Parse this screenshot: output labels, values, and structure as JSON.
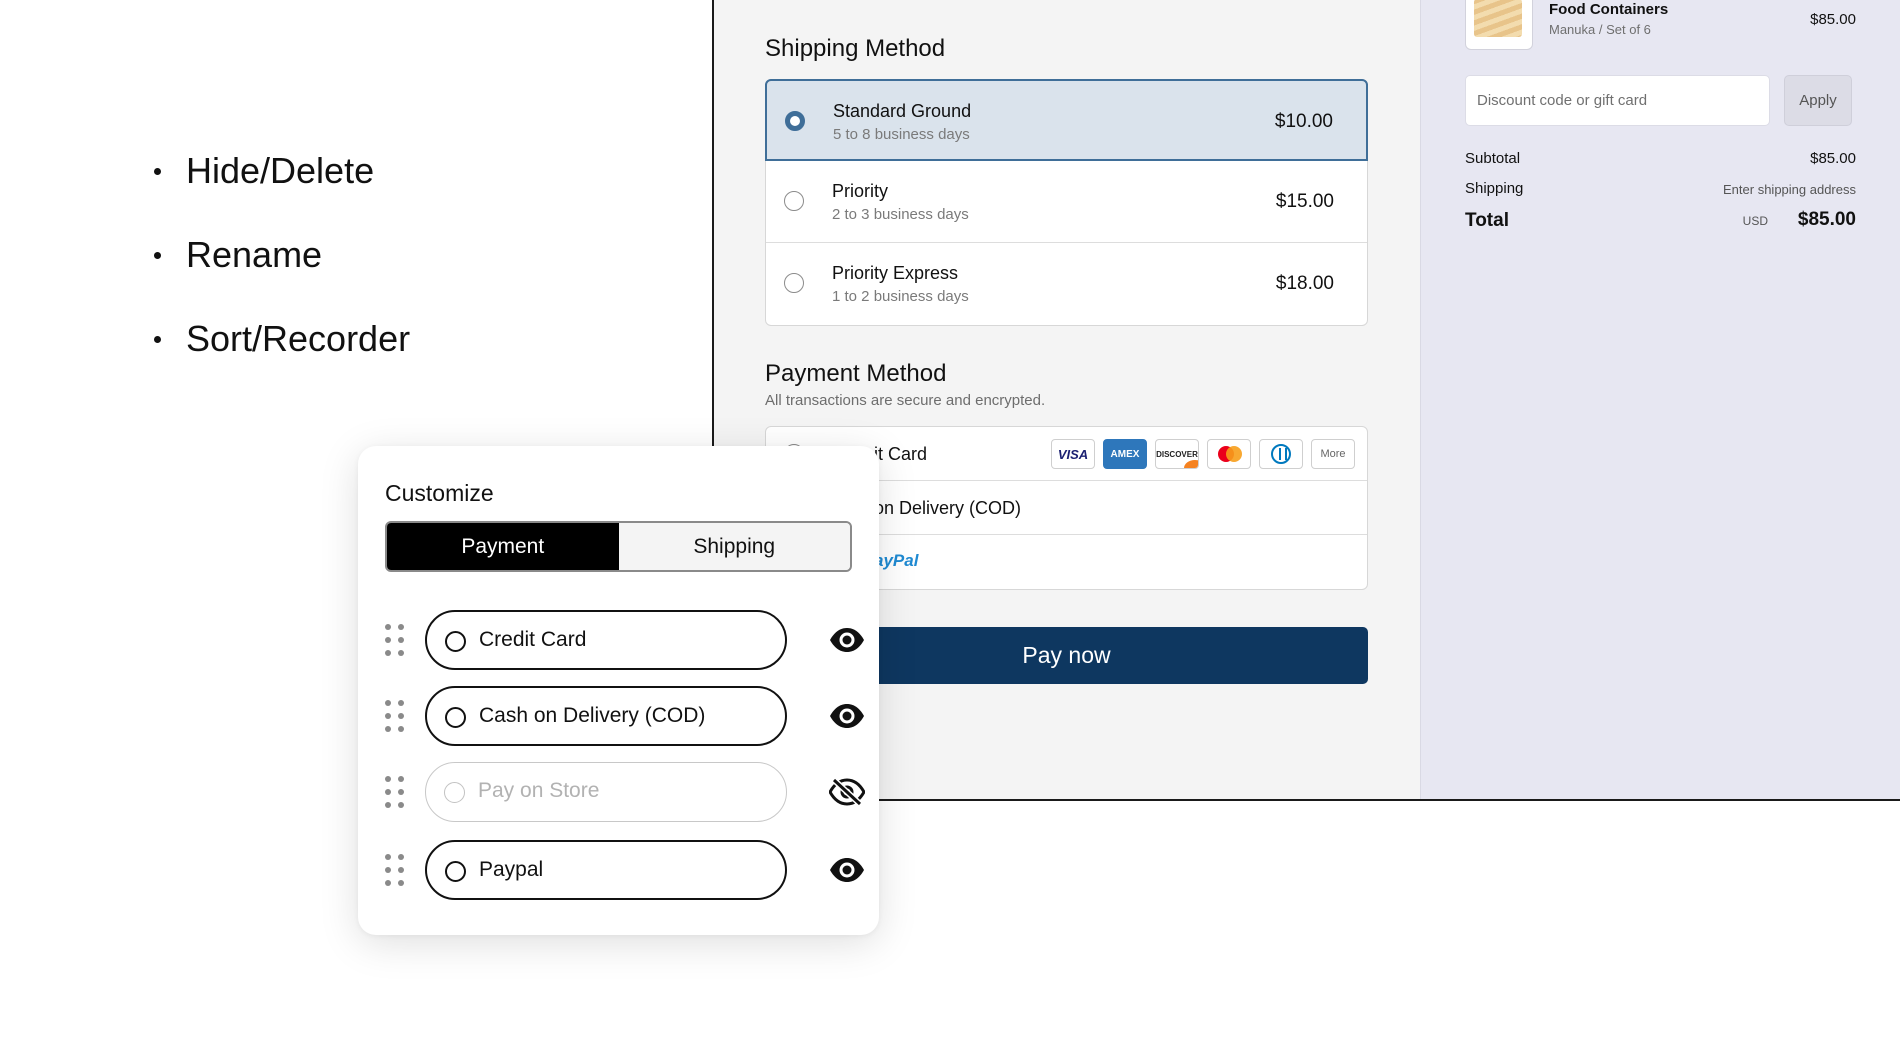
{
  "features": [
    "Hide/Delete",
    "Rename",
    "Sort/Recorder"
  ],
  "checkout": {
    "shipping": {
      "title": "Shipping Method",
      "options": [
        {
          "name": "Standard Ground",
          "days": "5 to 8 business days",
          "price": "$10.00",
          "selected": true
        },
        {
          "name": "Priority",
          "days": "2 to 3 business days",
          "price": "$15.00",
          "selected": false
        },
        {
          "name": "Priority Express",
          "days": "1 to 2 business days",
          "price": "$18.00",
          "selected": false
        }
      ]
    },
    "payment": {
      "title": "Payment Method",
      "subtitle": "All transactions are secure and encrypted.",
      "options": [
        {
          "label": "it Card"
        },
        {
          "label": "on Delivery (COD)"
        },
        {
          "label": "ayPal"
        }
      ],
      "card_logos": [
        "VISA",
        "AMEX",
        "DISCOVER",
        "mastercard",
        "diners",
        "More"
      ],
      "pay_button": "Pay now",
      "colors": {
        "accent": "#3f6e98",
        "pay_button": "#0e3760",
        "paypal": "#1f8ad2"
      }
    },
    "summary": {
      "product": {
        "name": "Food Containers",
        "variant": "Manuka / Set of 6",
        "price": "$85.00"
      },
      "discount_placeholder": "Discount code or gift card",
      "apply_label": "Apply",
      "subtotal_label": "Subtotal",
      "subtotal_value": "$85.00",
      "shipping_label": "Shipping",
      "shipping_value": "Enter shipping address",
      "total_label": "Total",
      "currency": "USD",
      "total_value": "$85.00"
    }
  },
  "customize": {
    "title": "Customize",
    "tabs": [
      {
        "label": "Payment",
        "active": true
      },
      {
        "label": "Shipping",
        "active": false
      }
    ],
    "options": [
      {
        "label": "Credit Card",
        "visible": true,
        "icon": "eye-icon"
      },
      {
        "label": "Cash on Delivery (COD)",
        "visible": true,
        "icon": "eye-icon"
      },
      {
        "label": "Pay on Store",
        "visible": false,
        "icon": "eye-off-icon"
      },
      {
        "label": "Paypal",
        "visible": true,
        "icon": "eye-icon"
      }
    ]
  }
}
